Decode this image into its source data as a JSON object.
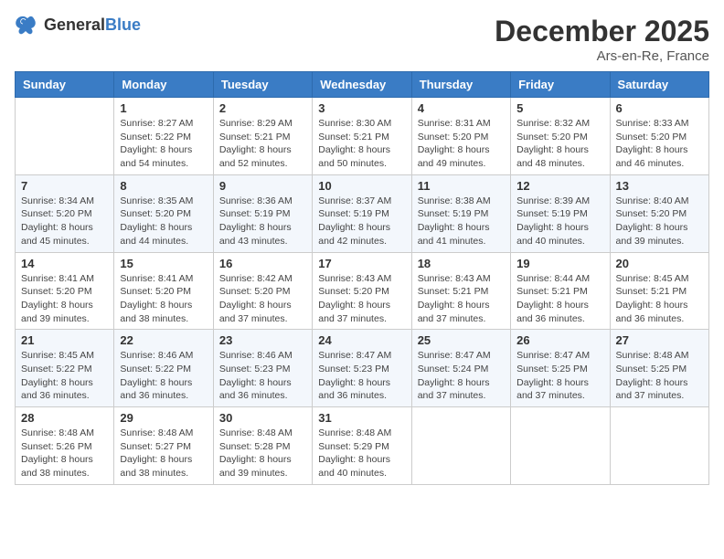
{
  "header": {
    "logo_general": "General",
    "logo_blue": "Blue",
    "month_title": "December 2025",
    "location": "Ars-en-Re, France"
  },
  "days_of_week": [
    "Sunday",
    "Monday",
    "Tuesday",
    "Wednesday",
    "Thursday",
    "Friday",
    "Saturday"
  ],
  "weeks": [
    [
      {
        "day": "",
        "info": ""
      },
      {
        "day": "1",
        "info": "Sunrise: 8:27 AM\nSunset: 5:22 PM\nDaylight: 8 hours\nand 54 minutes."
      },
      {
        "day": "2",
        "info": "Sunrise: 8:29 AM\nSunset: 5:21 PM\nDaylight: 8 hours\nand 52 minutes."
      },
      {
        "day": "3",
        "info": "Sunrise: 8:30 AM\nSunset: 5:21 PM\nDaylight: 8 hours\nand 50 minutes."
      },
      {
        "day": "4",
        "info": "Sunrise: 8:31 AM\nSunset: 5:20 PM\nDaylight: 8 hours\nand 49 minutes."
      },
      {
        "day": "5",
        "info": "Sunrise: 8:32 AM\nSunset: 5:20 PM\nDaylight: 8 hours\nand 48 minutes."
      },
      {
        "day": "6",
        "info": "Sunrise: 8:33 AM\nSunset: 5:20 PM\nDaylight: 8 hours\nand 46 minutes."
      }
    ],
    [
      {
        "day": "7",
        "info": "Sunrise: 8:34 AM\nSunset: 5:20 PM\nDaylight: 8 hours\nand 45 minutes."
      },
      {
        "day": "8",
        "info": "Sunrise: 8:35 AM\nSunset: 5:20 PM\nDaylight: 8 hours\nand 44 minutes."
      },
      {
        "day": "9",
        "info": "Sunrise: 8:36 AM\nSunset: 5:19 PM\nDaylight: 8 hours\nand 43 minutes."
      },
      {
        "day": "10",
        "info": "Sunrise: 8:37 AM\nSunset: 5:19 PM\nDaylight: 8 hours\nand 42 minutes."
      },
      {
        "day": "11",
        "info": "Sunrise: 8:38 AM\nSunset: 5:19 PM\nDaylight: 8 hours\nand 41 minutes."
      },
      {
        "day": "12",
        "info": "Sunrise: 8:39 AM\nSunset: 5:19 PM\nDaylight: 8 hours\nand 40 minutes."
      },
      {
        "day": "13",
        "info": "Sunrise: 8:40 AM\nSunset: 5:20 PM\nDaylight: 8 hours\nand 39 minutes."
      }
    ],
    [
      {
        "day": "14",
        "info": "Sunrise: 8:41 AM\nSunset: 5:20 PM\nDaylight: 8 hours\nand 39 minutes."
      },
      {
        "day": "15",
        "info": "Sunrise: 8:41 AM\nSunset: 5:20 PM\nDaylight: 8 hours\nand 38 minutes."
      },
      {
        "day": "16",
        "info": "Sunrise: 8:42 AM\nSunset: 5:20 PM\nDaylight: 8 hours\nand 37 minutes."
      },
      {
        "day": "17",
        "info": "Sunrise: 8:43 AM\nSunset: 5:20 PM\nDaylight: 8 hours\nand 37 minutes."
      },
      {
        "day": "18",
        "info": "Sunrise: 8:43 AM\nSunset: 5:21 PM\nDaylight: 8 hours\nand 37 minutes."
      },
      {
        "day": "19",
        "info": "Sunrise: 8:44 AM\nSunset: 5:21 PM\nDaylight: 8 hours\nand 36 minutes."
      },
      {
        "day": "20",
        "info": "Sunrise: 8:45 AM\nSunset: 5:21 PM\nDaylight: 8 hours\nand 36 minutes."
      }
    ],
    [
      {
        "day": "21",
        "info": "Sunrise: 8:45 AM\nSunset: 5:22 PM\nDaylight: 8 hours\nand 36 minutes."
      },
      {
        "day": "22",
        "info": "Sunrise: 8:46 AM\nSunset: 5:22 PM\nDaylight: 8 hours\nand 36 minutes."
      },
      {
        "day": "23",
        "info": "Sunrise: 8:46 AM\nSunset: 5:23 PM\nDaylight: 8 hours\nand 36 minutes."
      },
      {
        "day": "24",
        "info": "Sunrise: 8:47 AM\nSunset: 5:23 PM\nDaylight: 8 hours\nand 36 minutes."
      },
      {
        "day": "25",
        "info": "Sunrise: 8:47 AM\nSunset: 5:24 PM\nDaylight: 8 hours\nand 37 minutes."
      },
      {
        "day": "26",
        "info": "Sunrise: 8:47 AM\nSunset: 5:25 PM\nDaylight: 8 hours\nand 37 minutes."
      },
      {
        "day": "27",
        "info": "Sunrise: 8:48 AM\nSunset: 5:25 PM\nDaylight: 8 hours\nand 37 minutes."
      }
    ],
    [
      {
        "day": "28",
        "info": "Sunrise: 8:48 AM\nSunset: 5:26 PM\nDaylight: 8 hours\nand 38 minutes."
      },
      {
        "day": "29",
        "info": "Sunrise: 8:48 AM\nSunset: 5:27 PM\nDaylight: 8 hours\nand 38 minutes."
      },
      {
        "day": "30",
        "info": "Sunrise: 8:48 AM\nSunset: 5:28 PM\nDaylight: 8 hours\nand 39 minutes."
      },
      {
        "day": "31",
        "info": "Sunrise: 8:48 AM\nSunset: 5:29 PM\nDaylight: 8 hours\nand 40 minutes."
      },
      {
        "day": "",
        "info": ""
      },
      {
        "day": "",
        "info": ""
      },
      {
        "day": "",
        "info": ""
      }
    ]
  ]
}
